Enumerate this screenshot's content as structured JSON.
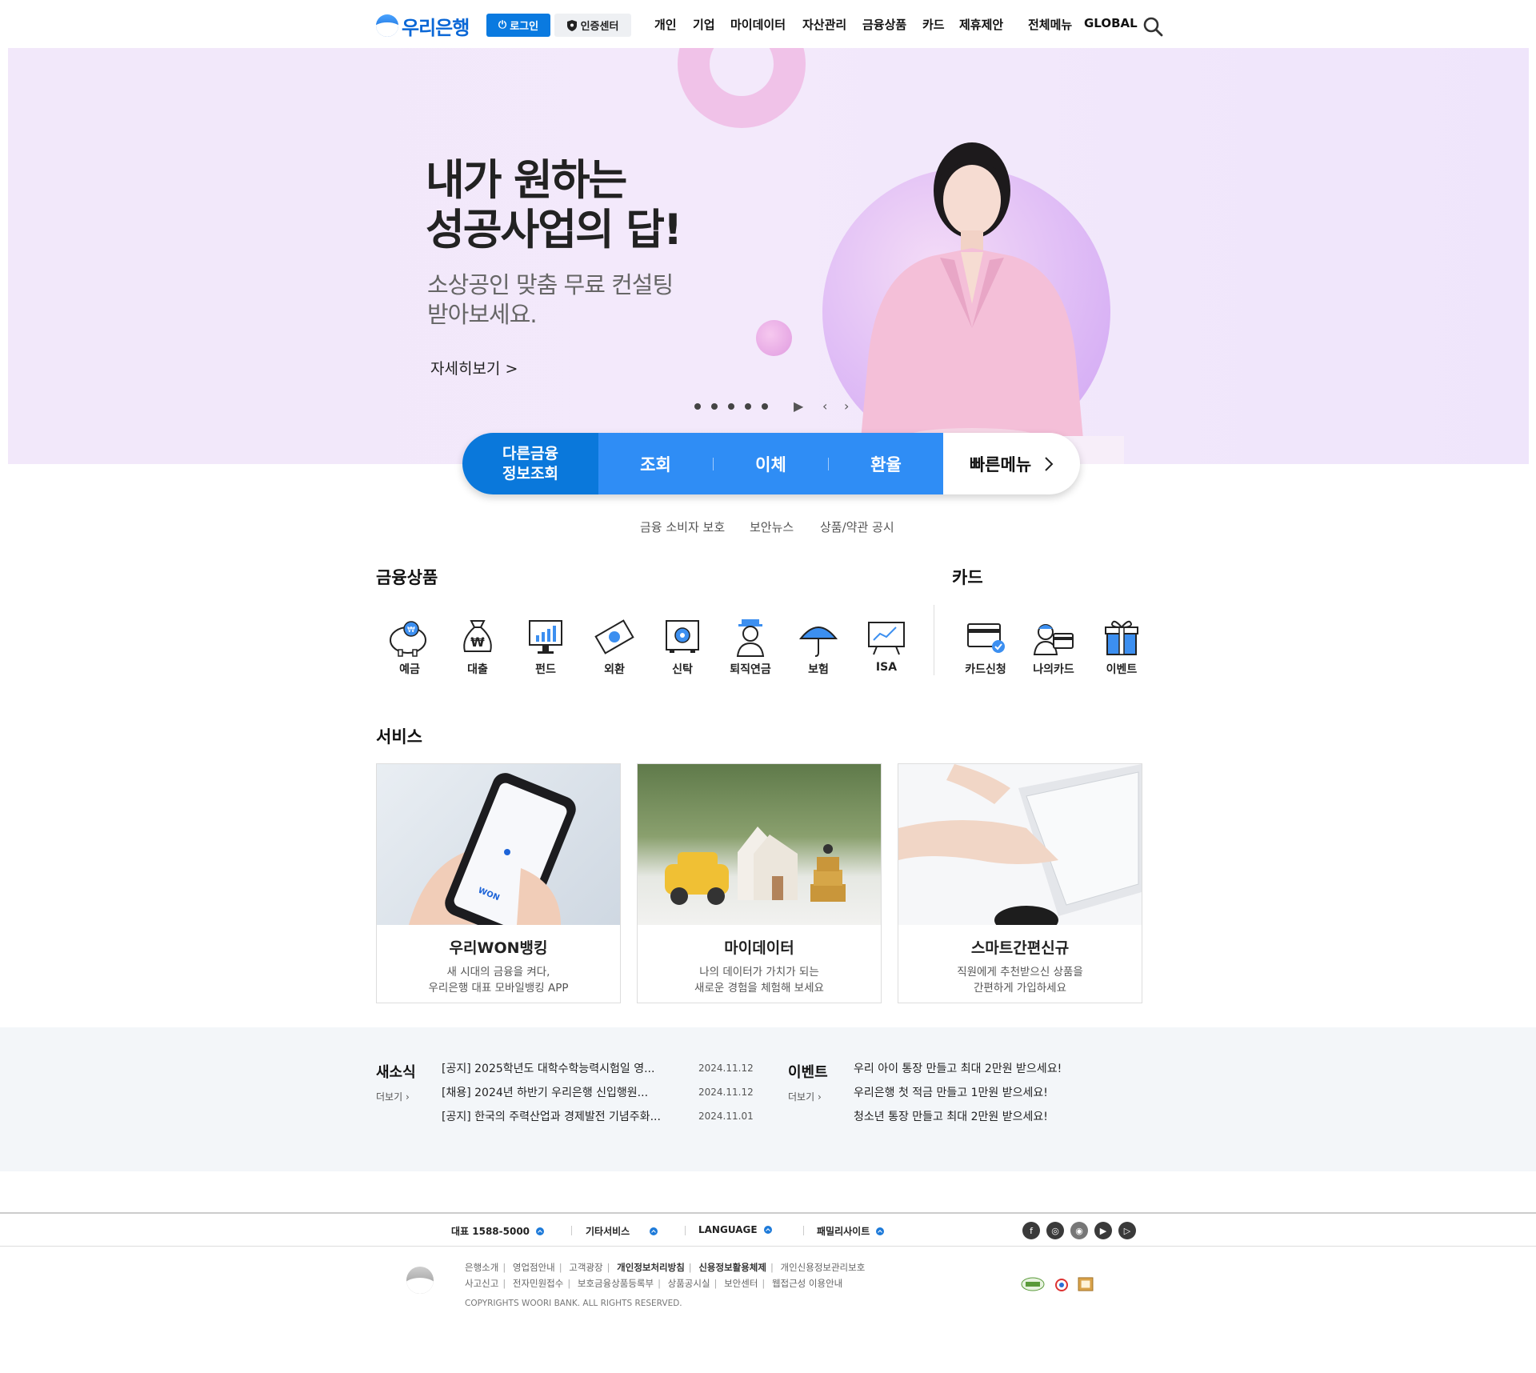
{
  "header": {
    "logo_text": "우리은행",
    "login_label": "로그인",
    "cert_label": "인증센터",
    "nav": [
      "개인",
      "기업",
      "마이데이터",
      "자산관리",
      "금융상품",
      "카드",
      "제휴제안"
    ],
    "all_menu": "전체메뉴",
    "global": "GLOBAL"
  },
  "hero": {
    "title": "내가 원하는\n성공사업의 답!",
    "subtitle": "소상공인 맞춤 무료 컨설팅\n받아보세요.",
    "more": "자세히보기 >",
    "slide_count": 5
  },
  "quick": {
    "first": "다른금융\n정보조회",
    "items": [
      "조회",
      "이체",
      "환율"
    ],
    "last": "빠른메뉴"
  },
  "sublinks": [
    "금융 소비자 보호",
    "보안뉴스",
    "상품/약관 공시"
  ],
  "products": {
    "title": "금융상품",
    "items": [
      "예금",
      "대출",
      "펀드",
      "외환",
      "신탁",
      "퇴직연금",
      "보험",
      "ISA"
    ]
  },
  "cards": {
    "title": "카드",
    "items": [
      "카드신청",
      "나의카드",
      "이벤트"
    ]
  },
  "services": {
    "title": "서비스",
    "items": [
      {
        "title": "우리WON뱅킹",
        "desc": "새 시대의 금융을 켜다,\n우리은행 대표 모바일뱅킹 APP"
      },
      {
        "title": "마이데이터",
        "desc": "나의 데이터가 가치가 되는\n새로운 경험을 체험해 보세요"
      },
      {
        "title": "스마트간편신규",
        "desc": "직원에게 추천받으신 상품을\n간편하게 가입하세요"
      }
    ]
  },
  "news": {
    "title": "새소식",
    "more": "더보기",
    "items": [
      {
        "text": "[공지] 2025학년도 대학수학능력시험일 영...",
        "date": "2024.11.12"
      },
      {
        "text": "[채용] 2024년 하반기 우리은행 신입행원...",
        "date": "2024.11.12"
      },
      {
        "text": "[공지] 한국의 주력산업과 경제발전 기념주화...",
        "date": "2024.11.01"
      }
    ]
  },
  "events": {
    "title": "이벤트",
    "more": "더보기",
    "items": [
      "우리 아이 통장 만들고 최대 2만원 받으세요!",
      "우리은행 첫 적금 만들고 1만원 받으세요!",
      "청소년 통장 만들고 최대 2만원 받으세요!"
    ]
  },
  "footer_bar": {
    "phone": "대표 1588-5000",
    "etc": "기타서비스",
    "language": "LANGUAGE",
    "family": "패밀리사이트"
  },
  "footer": {
    "row1": [
      "은행소개",
      "영업점안내",
      "고객광장",
      "개인정보처리방침",
      "신용정보활용체제",
      "개인신용정보관리보호"
    ],
    "row2": [
      "사고신고",
      "전자민원접수",
      "보호금융상품등록부",
      "상품공시실",
      "보안센터",
      "웹접근성 이용안내"
    ],
    "copyright": "COPYRIGHTS WOORI BANK. ALL RIGHTS RESERVED."
  },
  "colors": {
    "brand": "#0a78db",
    "quick_bar": "#2f8df5",
    "hero_bg": "#f2e8fa"
  }
}
